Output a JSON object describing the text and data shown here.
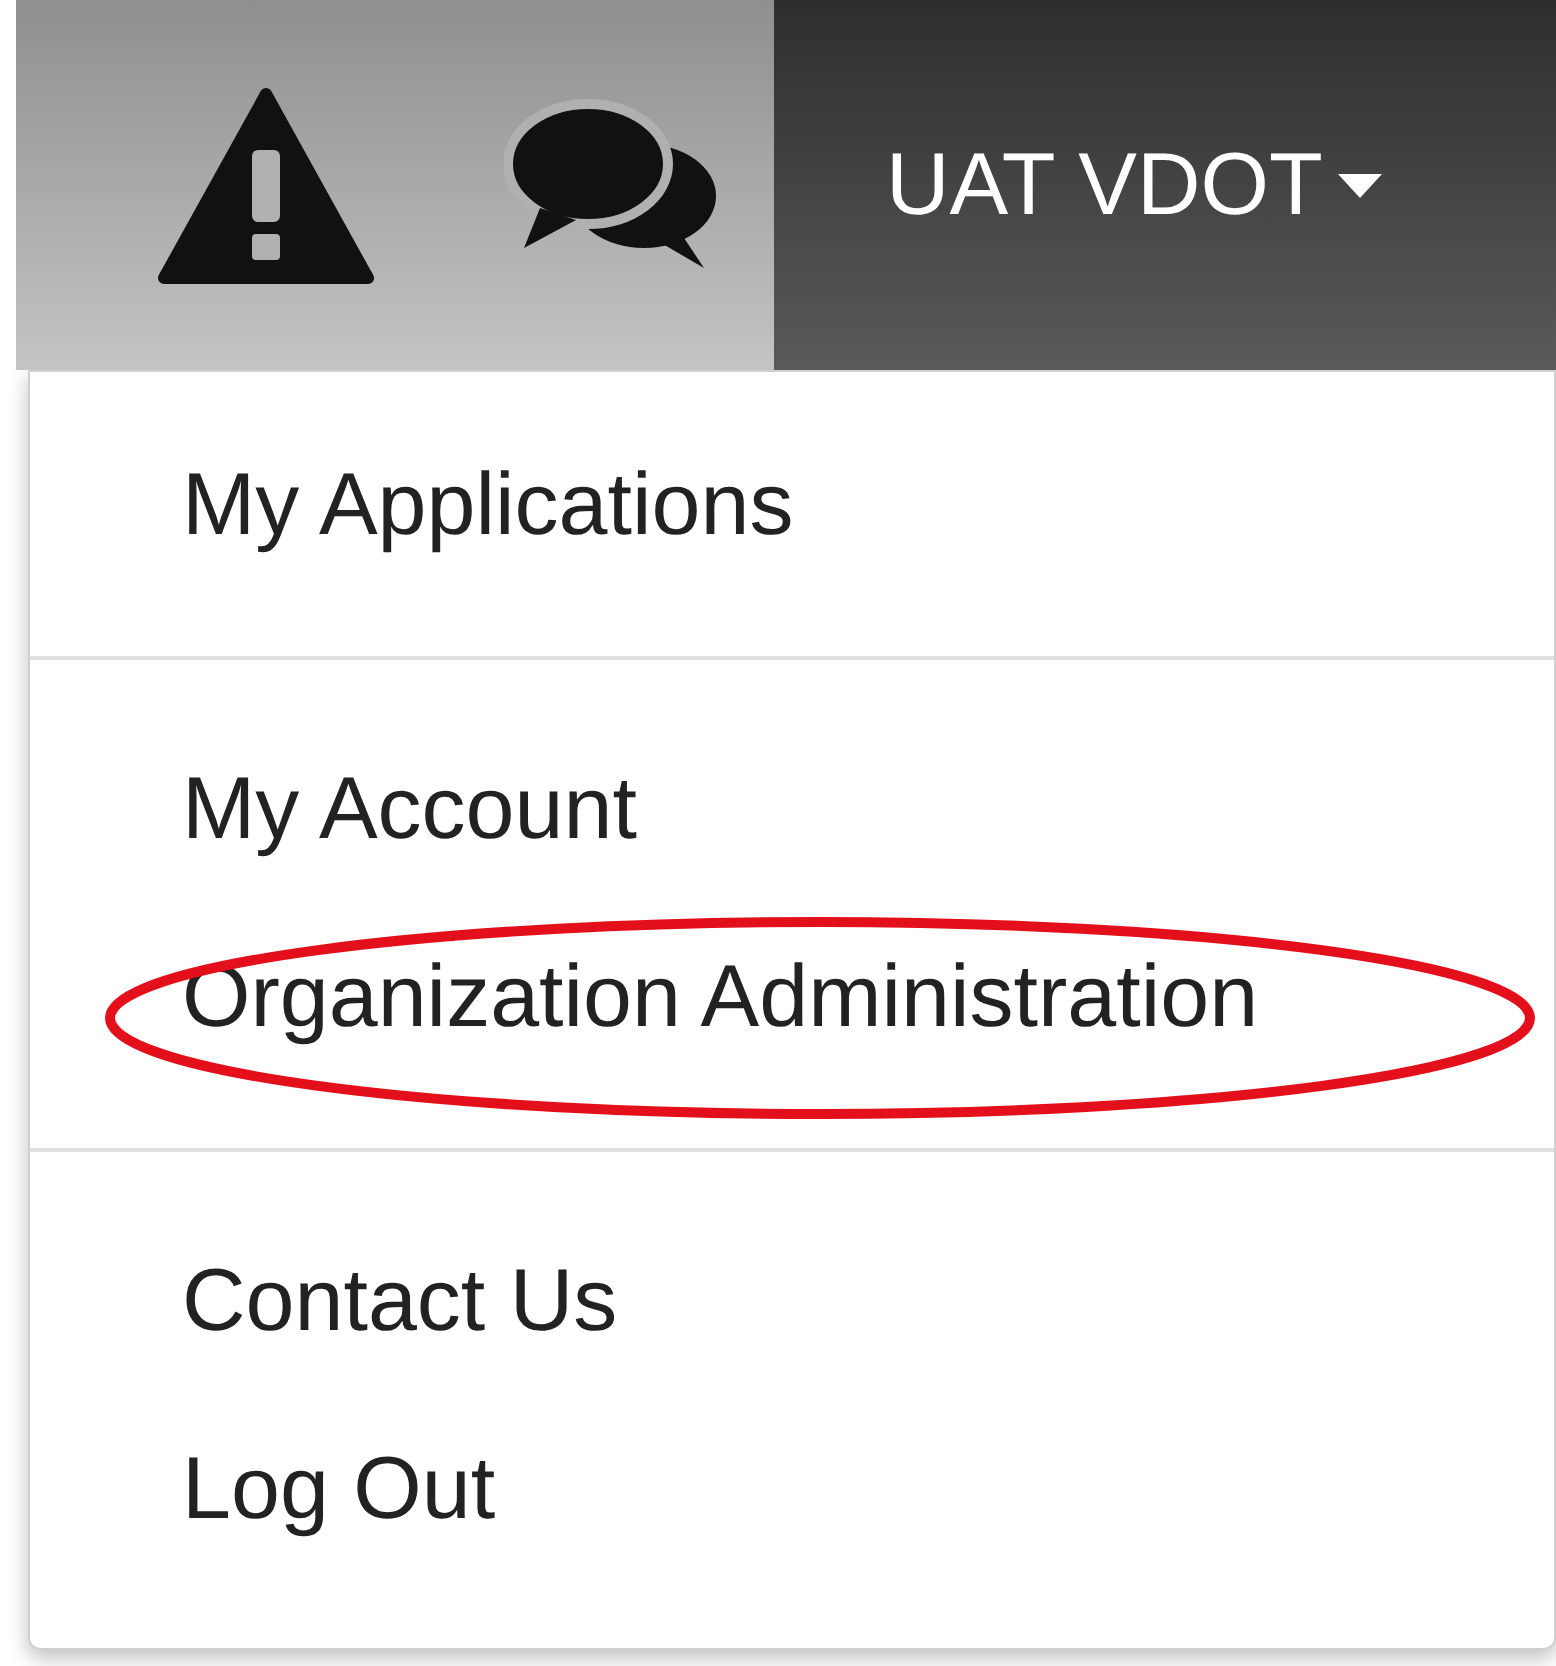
{
  "navbar": {
    "user_menu": {
      "label": "UAT VDOT",
      "expanded": true
    }
  },
  "dropdown": {
    "items": [
      {
        "kind": "item",
        "label": "My Applications",
        "highlighted": false
      },
      {
        "kind": "divider"
      },
      {
        "kind": "item",
        "label": "My Account",
        "highlighted": false
      },
      {
        "kind": "item",
        "label": "Organization Administration",
        "highlighted": true
      },
      {
        "kind": "divider"
      },
      {
        "kind": "item",
        "label": "Contact Us",
        "highlighted": false
      },
      {
        "kind": "item",
        "label": "Log Out",
        "highlighted": false
      }
    ]
  }
}
